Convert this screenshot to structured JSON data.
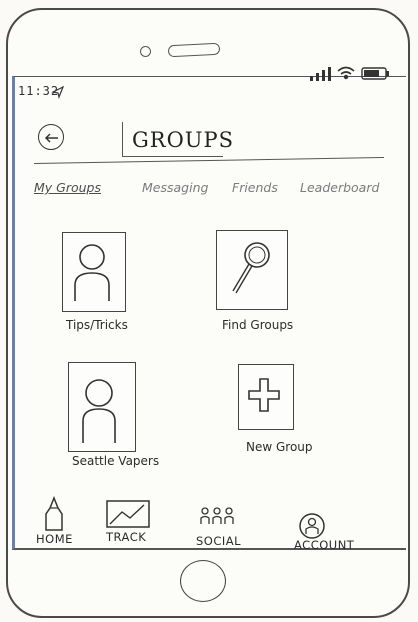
{
  "status": {
    "time": "11:32"
  },
  "header": {
    "title": "GROUPS"
  },
  "tabs": [
    {
      "label": "My Groups",
      "active": true
    },
    {
      "label": "Messaging"
    },
    {
      "label": "Friends"
    },
    {
      "label": "Leaderboard"
    }
  ],
  "tiles": {
    "tips": "Tips/Tricks",
    "find": "Find Groups",
    "seattle": "Seattle Vapers",
    "new_group": "New Group"
  },
  "nav": {
    "home": "HOME",
    "track": "TRACK",
    "social": "SOCIAL",
    "account": "ACCOUNT"
  }
}
